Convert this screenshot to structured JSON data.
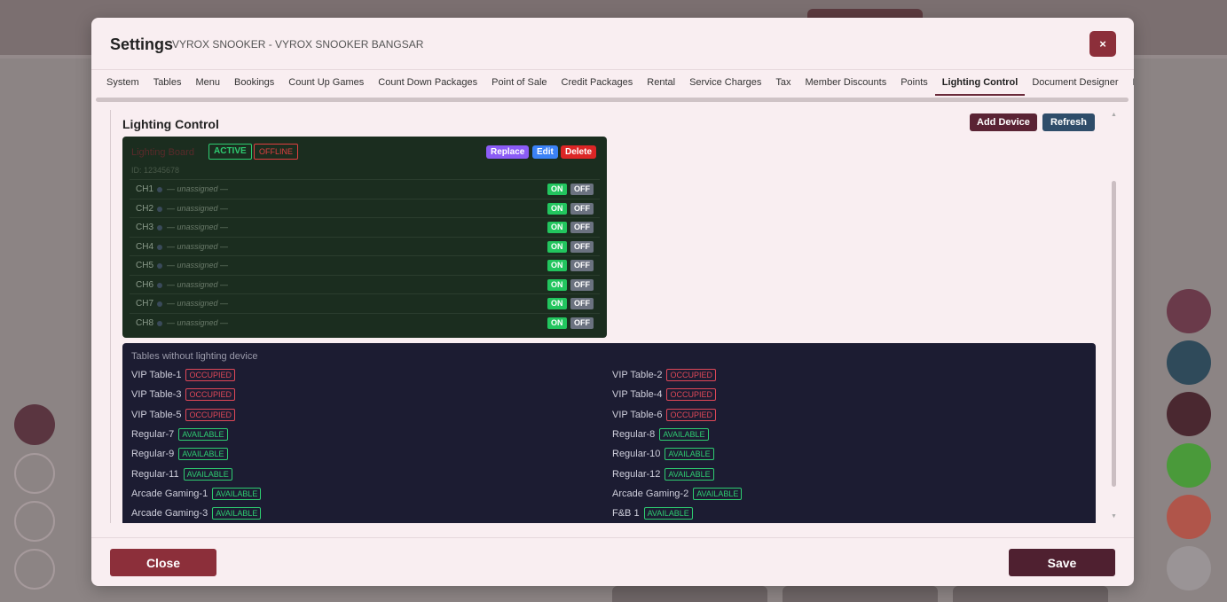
{
  "modal": {
    "title": "Settings",
    "subtitle": "VYROX SNOOKER - VYROX SNOOKER BANGSAR",
    "close_icon": "×"
  },
  "tabs": [
    {
      "label": "System"
    },
    {
      "label": "Tables"
    },
    {
      "label": "Menu"
    },
    {
      "label": "Bookings"
    },
    {
      "label": "Count Up Games"
    },
    {
      "label": "Count Down Packages"
    },
    {
      "label": "Point of Sale"
    },
    {
      "label": "Credit Packages"
    },
    {
      "label": "Rental"
    },
    {
      "label": "Service Charges"
    },
    {
      "label": "Tax"
    },
    {
      "label": "Member Discounts"
    },
    {
      "label": "Points"
    },
    {
      "label": "Lighting Control",
      "active": true
    },
    {
      "label": "Document Designer"
    },
    {
      "label": "Printers"
    }
  ],
  "lighting": {
    "title": "Lighting Control",
    "add_device_label": "Add Device",
    "refresh_label": "Refresh"
  },
  "device": {
    "name": "Lighting Board",
    "status_active": "ACTIVE",
    "status_offline": "OFFLINE",
    "replace_label": "Replace",
    "edit_label": "Edit",
    "delete_label": "Delete",
    "id_text": "ID: 12345678",
    "channels": [
      {
        "label": "CH1",
        "assignment": "— unassigned —",
        "on": "ON",
        "off": "OFF"
      },
      {
        "label": "CH2",
        "assignment": "— unassigned —",
        "on": "ON",
        "off": "OFF"
      },
      {
        "label": "CH3",
        "assignment": "— unassigned —",
        "on": "ON",
        "off": "OFF"
      },
      {
        "label": "CH4",
        "assignment": "— unassigned —",
        "on": "ON",
        "off": "OFF"
      },
      {
        "label": "CH5",
        "assignment": "— unassigned —",
        "on": "ON",
        "off": "OFF"
      },
      {
        "label": "CH6",
        "assignment": "— unassigned —",
        "on": "ON",
        "off": "OFF"
      },
      {
        "label": "CH7",
        "assignment": "— unassigned —",
        "on": "ON",
        "off": "OFF"
      },
      {
        "label": "CH8",
        "assignment": "— unassigned —",
        "on": "ON",
        "off": "OFF"
      }
    ]
  },
  "tables_panel": {
    "title": "Tables without lighting device",
    "tables": [
      {
        "name": "VIP Table-1",
        "status": "OCCUPIED"
      },
      {
        "name": "VIP Table-2",
        "status": "OCCUPIED"
      },
      {
        "name": "VIP Table-3",
        "status": "OCCUPIED"
      },
      {
        "name": "VIP Table-4",
        "status": "OCCUPIED"
      },
      {
        "name": "VIP Table-5",
        "status": "OCCUPIED"
      },
      {
        "name": "VIP Table-6",
        "status": "OCCUPIED"
      },
      {
        "name": "Regular-7",
        "status": "AVAILABLE"
      },
      {
        "name": "Regular-8",
        "status": "AVAILABLE"
      },
      {
        "name": "Regular-9",
        "status": "AVAILABLE"
      },
      {
        "name": "Regular-10",
        "status": "AVAILABLE"
      },
      {
        "name": "Regular-11",
        "status": "AVAILABLE"
      },
      {
        "name": "Regular-12",
        "status": "AVAILABLE"
      },
      {
        "name": "Arcade Gaming-1",
        "status": "AVAILABLE"
      },
      {
        "name": "Arcade Gaming-2",
        "status": "AVAILABLE"
      },
      {
        "name": "Arcade Gaming-3",
        "status": "AVAILABLE"
      },
      {
        "name": "F&B 1",
        "status": "AVAILABLE"
      }
    ]
  },
  "footer": {
    "close_label": "Close",
    "save_label": "Save"
  },
  "colors": {
    "primary": "#8c2f3a",
    "save": "#4f2030",
    "refresh": "#2f4d6a",
    "occupied": "#e04858",
    "available": "#2ecc71"
  }
}
